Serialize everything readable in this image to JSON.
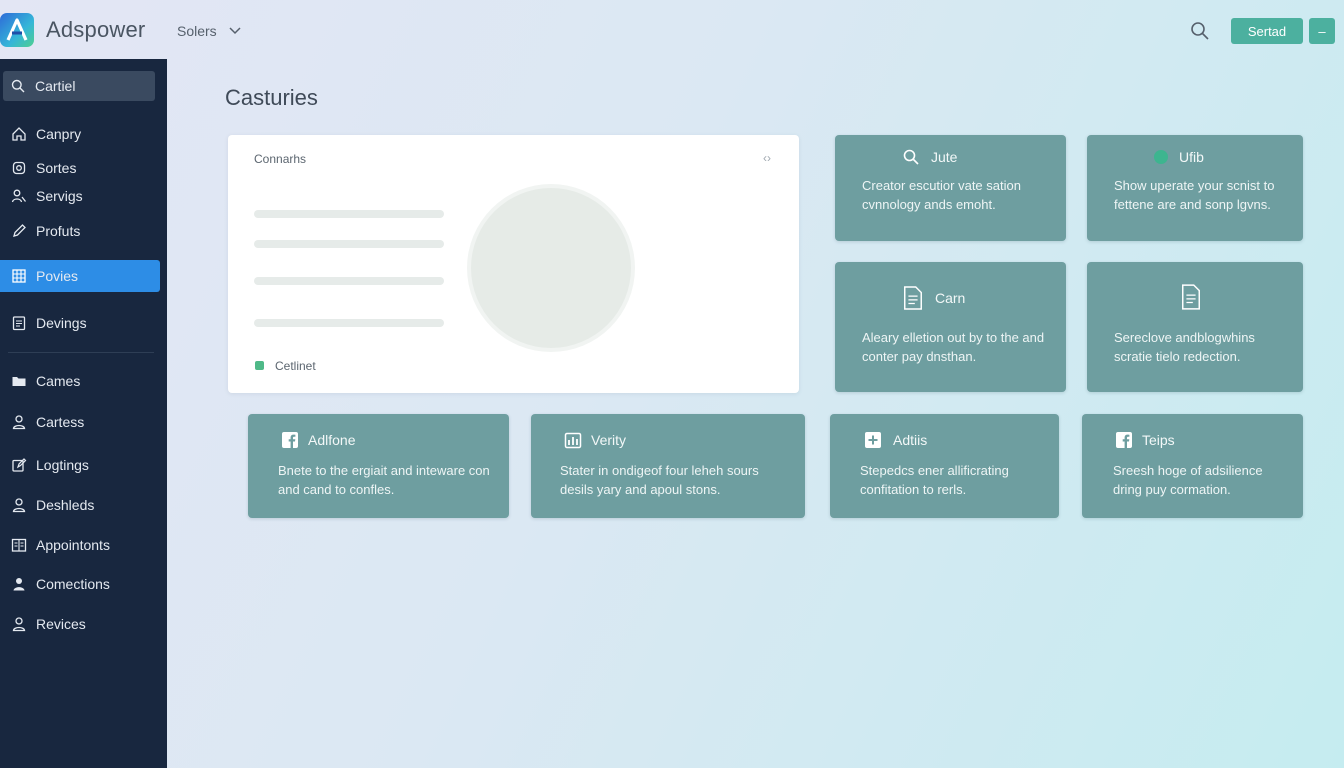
{
  "app": {
    "name": "Adspower",
    "menu_label": "Solers",
    "primary_button": "Sertad",
    "more_button": "–"
  },
  "sidebar": {
    "search_label": "Cartiel",
    "items": [
      {
        "label": "Canpry",
        "icon": "home-icon"
      },
      {
        "label": "Sortes",
        "icon": "settings-icon"
      },
      {
        "label": "Servigs",
        "icon": "users-icon"
      },
      {
        "label": "Profuts",
        "icon": "pen-icon"
      },
      {
        "label": "Povies",
        "icon": "grid-icon",
        "active": true
      },
      {
        "label": "Devings",
        "icon": "document-icon"
      },
      {
        "label": "Cames",
        "icon": "folder-icon"
      },
      {
        "label": "Cartess",
        "icon": "user-icon"
      },
      {
        "label": "Logtings",
        "icon": "edit-icon"
      },
      {
        "label": "Deshleds",
        "icon": "people-icon"
      },
      {
        "label": "Appointonts",
        "icon": "calendar-icon"
      },
      {
        "label": "Comections",
        "icon": "person-filled-icon"
      },
      {
        "label": "Revices",
        "icon": "user-icon"
      }
    ]
  },
  "main": {
    "title": "Casturies",
    "panel": {
      "title": "Connarhs",
      "status_label": "Cetlinet",
      "status_color": "#4fb988"
    },
    "cards": [
      {
        "title": "Jute",
        "icon": "search-icon",
        "text": "Creator escutior vate sation cvnnology ands emoht."
      },
      {
        "title": "Ufib",
        "icon": "dot-icon",
        "text": "Show uperate your scnist to fettene are and sonp lgvns."
      },
      {
        "title": "Carn",
        "icon": "document-icon",
        "text": "Aleary elletion out by to the and conter pay dnsthan."
      },
      {
        "title": "",
        "icon": "document-icon",
        "text": "Sereclove andblogwhins scratie tielo redection."
      },
      {
        "title": "Adlfone",
        "icon": "facebook-icon",
        "text": "Bnete to the ergiait and inteware con and cand to confles."
      },
      {
        "title": "Verity",
        "icon": "chart-icon",
        "text": "Stater in ondigeof four leheh sours desils yary and apoul stons."
      },
      {
        "title": "Adtiis",
        "icon": "plus-icon",
        "text": "Stepedcs ener allificrating confitation to rerls."
      },
      {
        "title": "Teips",
        "icon": "facebook-icon",
        "text": "Sreesh hoge of adsilience dring puy cormation."
      }
    ]
  },
  "colors": {
    "sidebar_bg": "#18273f",
    "active_item": "#2d8de6",
    "accent_button": "#4cb09f",
    "card_bg": "#6e9ea0"
  }
}
